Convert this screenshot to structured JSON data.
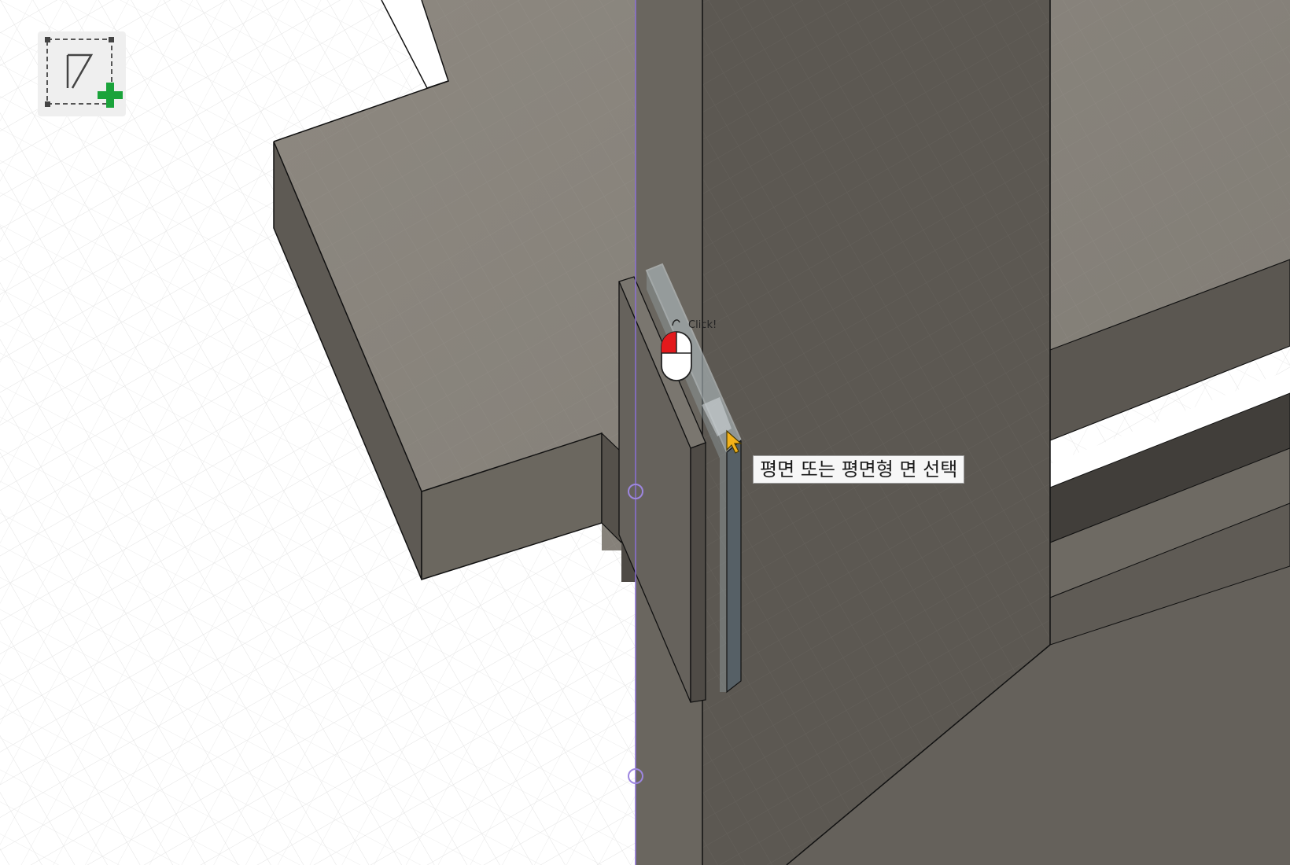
{
  "app": {
    "viewport_name": "3d-model-viewport",
    "body_color": "#5f5b55",
    "body_top_color": "#8c877f",
    "grid_background": "#ffffff",
    "grid_line_color": "#dcdcdc",
    "axis_color": "#8a6fd6",
    "highlight_color": "#bfcfd6"
  },
  "sketch_tool": {
    "icon": "create-sketch-icon",
    "plus_color": "#1aa33a"
  },
  "cursor_hint": {
    "text": "평면 또는 평면형 면 선택"
  },
  "mouse_indicator": {
    "icon": "mouse-left-click-icon",
    "label": "Click!",
    "button_color": "#e3191c"
  }
}
